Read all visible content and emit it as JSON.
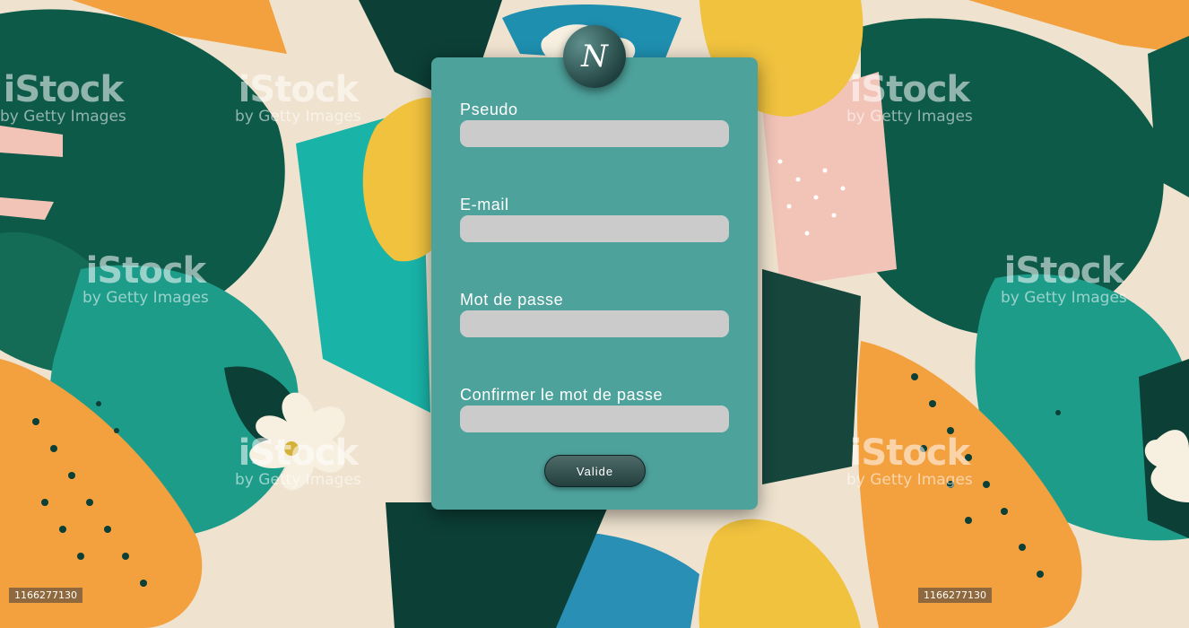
{
  "background": {
    "watermark_main": "iStock",
    "watermark_sub": "by Getty Images",
    "stock_id": "1166277130"
  },
  "logo": {
    "letter": "N"
  },
  "form": {
    "fields": [
      {
        "label": "Pseudo",
        "value": ""
      },
      {
        "label": "E-mail",
        "value": ""
      },
      {
        "label": "Mot de passe",
        "value": ""
      },
      {
        "label": "Confirmer le mot de passe",
        "value": ""
      }
    ],
    "submit_label": "Valide"
  },
  "colors": {
    "card": "#4ea29c",
    "field": "#cbcbcb",
    "button": "#2e4a48",
    "text": "#ffffff"
  }
}
